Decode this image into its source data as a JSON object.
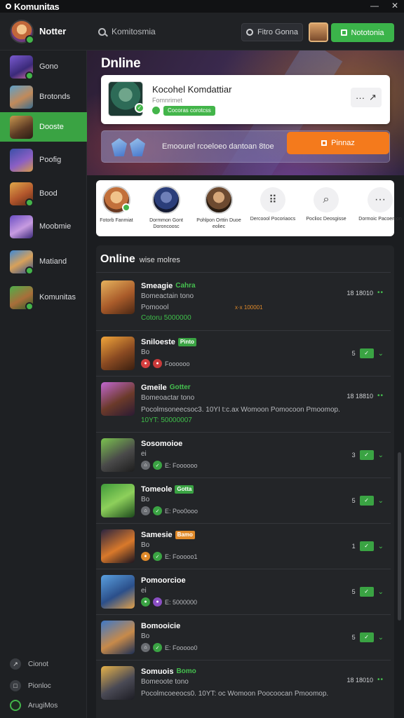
{
  "app": {
    "title": "Komunitas"
  },
  "window": {
    "minimize": "—",
    "close": "✕"
  },
  "header": {
    "user_name": "Notter",
    "search_placeholder": "Komitosmia",
    "search_button": "Fitro Gonna",
    "action_button": "Nototonia"
  },
  "sidebar": {
    "items": [
      {
        "label": "Gono"
      },
      {
        "label": "Brotonds"
      },
      {
        "label": "Dooste"
      },
      {
        "label": "Poofig"
      },
      {
        "label": "Bood"
      },
      {
        "label": "Moobmie"
      },
      {
        "label": "Matiand"
      },
      {
        "label": "Komunitas"
      }
    ],
    "bottom": [
      {
        "label": "Cionot"
      },
      {
        "label": "Pionloc"
      },
      {
        "label": "ArugiMos"
      }
    ]
  },
  "hero": {
    "title": "Dnline",
    "card": {
      "title": "Kocohel Komdattiar",
      "subtitle": "Fomnrimet",
      "badge": "Cocoras corotcss",
      "more": "···"
    },
    "promo": {
      "text": "Emoourel rcoeloeo dantoan 8toe",
      "button": "Pinnaz"
    }
  },
  "quick": [
    {
      "label": "Fotorb Fanmiat"
    },
    {
      "label": "Dormmon Gont Doroncoosc"
    },
    {
      "label": "Pohlpon Orttin Duoe eoliec"
    },
    {
      "label": "Dercoool Pocoriaocs"
    },
    {
      "label": "Poclioc Deosgisse"
    },
    {
      "label": "Dormoic Pacoemon"
    }
  ],
  "list": {
    "heading": "Online",
    "subheading": "wise molres",
    "rows": [
      {
        "name": "Smeagie",
        "tag": "Cahra",
        "line1": "Bomeactain tono",
        "line2": "Pomoool",
        "line3": "Cotoru 5000000",
        "extra": "x·x 100001",
        "meta": "18 18010",
        "meta_kind": "dots"
      },
      {
        "name": "Sniloeste",
        "tag": "Pinto",
        "line1": "Bo",
        "icons_text": "Foooooo",
        "count": "5",
        "meta_kind": "count"
      },
      {
        "name": "Gmeile",
        "tag": "Gotter",
        "line1": "Bomeoactar tono",
        "line2": "Pocolmsoneecsoc3. 10YI t:c.ax Womoon Pomocoon Pmoomop.",
        "line3": "10YT: 50000007",
        "meta": "18 18810",
        "meta_kind": "dots"
      },
      {
        "name": "Sosomoioe",
        "line1": "ei",
        "icons_text": "E: Foooooo",
        "count": "3",
        "meta_kind": "count"
      },
      {
        "name": "Tomeole",
        "tag": "Gotta",
        "line1": "Bo",
        "icons_text": "E: Poo0ooo",
        "count": "5",
        "meta_kind": "count"
      },
      {
        "name": "Samesie",
        "tag": "Bamo",
        "line1": "Bo",
        "icons_text": "E: Fooooo1",
        "count": "1",
        "meta_kind": "count"
      },
      {
        "name": "Pomoorcioe",
        "line1": "ei",
        "icons_text": "E: 5000000",
        "count": "5",
        "meta_kind": "count"
      },
      {
        "name": "Bomooicie",
        "line1": "Bo",
        "icons_text": "E: Fooooo0",
        "count": "5",
        "meta_kind": "count"
      },
      {
        "name": "Somuois",
        "tag": "Bomo",
        "line1": "Bomeoote tono",
        "line2": "Pocolmcoeeocs0. 10YT: oc Womoon Poocoocan Pmoomop.",
        "line3": "",
        "meta": "18 18010",
        "meta_kind": "dots"
      }
    ]
  },
  "colors": {
    "accent": "#3bb44a",
    "orange": "#f47a1c",
    "panel": "#232528",
    "background": "#1b1d20"
  }
}
